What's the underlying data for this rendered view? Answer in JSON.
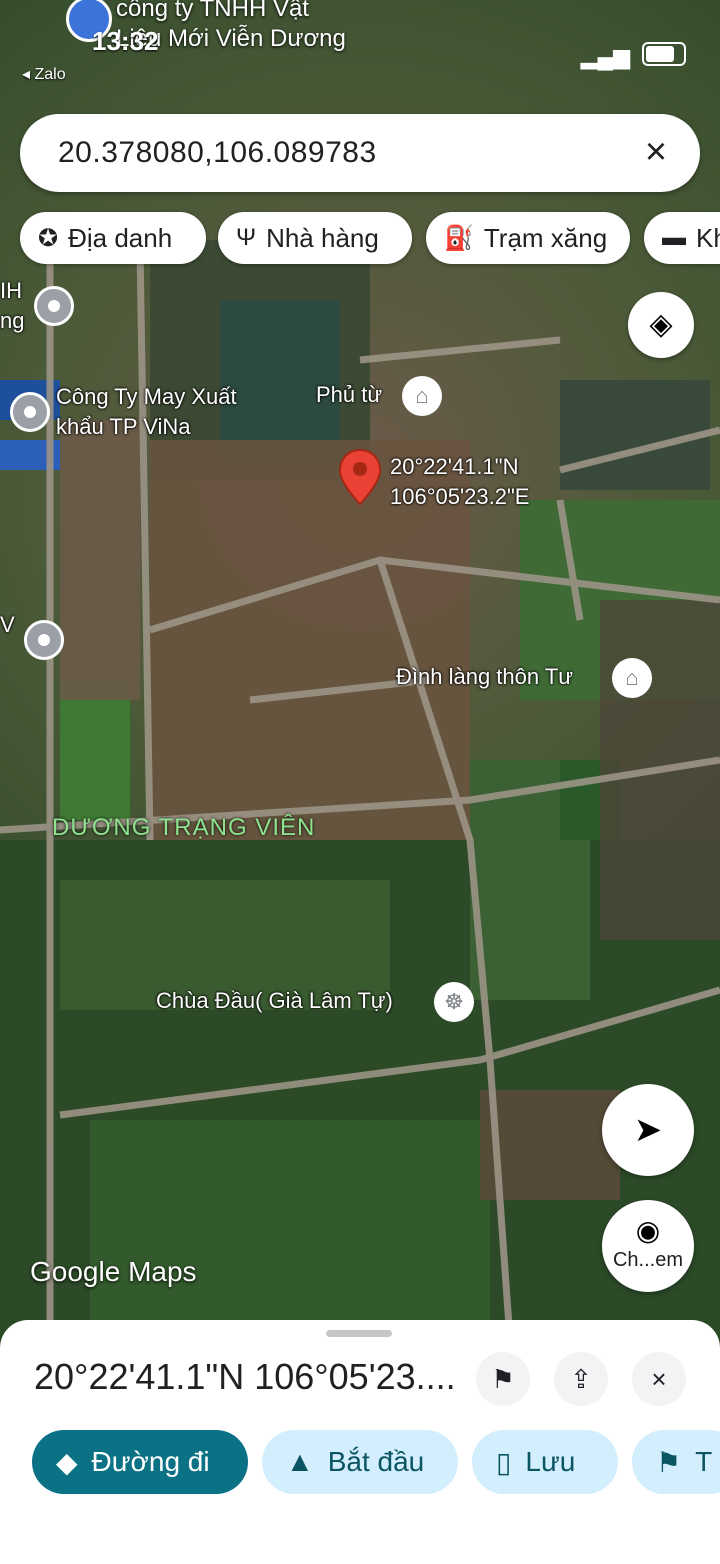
{
  "status_bar": {
    "time": "13:32",
    "back_app": "◂ Zalo",
    "top_poi": "công ty TNHH Vật\nLiệu Mới Viễn Dương"
  },
  "search": {
    "query": "20.378080,106.089783",
    "clear_icon": "close-icon"
  },
  "chips": [
    {
      "label": "Địa danh",
      "icon": "landmark-icon"
    },
    {
      "label": "Nhà hàng",
      "icon": "restaurant-icon"
    },
    {
      "label": "Trạm xăng",
      "icon": "gas-station-icon"
    },
    {
      "label": "Kh",
      "icon": "hotel-icon"
    }
  ],
  "map": {
    "pin_coords_lat": "20°22'41.1\"N",
    "pin_coords_lng": "106°05'23.2\"E",
    "pois": [
      {
        "label": "Công Ty May Xuất\nkhẩu TP ViNa",
        "icon": "pin-icon"
      },
      {
        "label": "Phủ từ",
        "icon": "landmark-icon"
      },
      {
        "label": "Đình làng thôn Tư",
        "icon": "landmark-icon"
      },
      {
        "label": "Chùa Đầu( Già Lâm Tự)",
        "icon": "temple-icon"
      },
      {
        "label": "IH\nng",
        "icon": "pin-icon"
      },
      {
        "label": "V",
        "icon": "pin-icon"
      }
    ],
    "area_label": "DƯƠNG TRẠNG VIÊN",
    "branding": "Google Maps"
  },
  "controls": {
    "lens_label": "Ch...em"
  },
  "sheet": {
    "title": "20°22'41.1\"N 106°05'23....",
    "actions": [
      {
        "label": "Đường đi",
        "icon": "directions-icon"
      },
      {
        "label": "Bắt đầu",
        "icon": "navigation-icon"
      },
      {
        "label": "Lưu",
        "icon": "bookmark-icon"
      },
      {
        "label": "T",
        "icon": "flag-icon"
      }
    ]
  },
  "colors": {
    "primary_action": "#0b7285",
    "secondary_action": "#d3eefc",
    "pin": "#ea4335"
  }
}
